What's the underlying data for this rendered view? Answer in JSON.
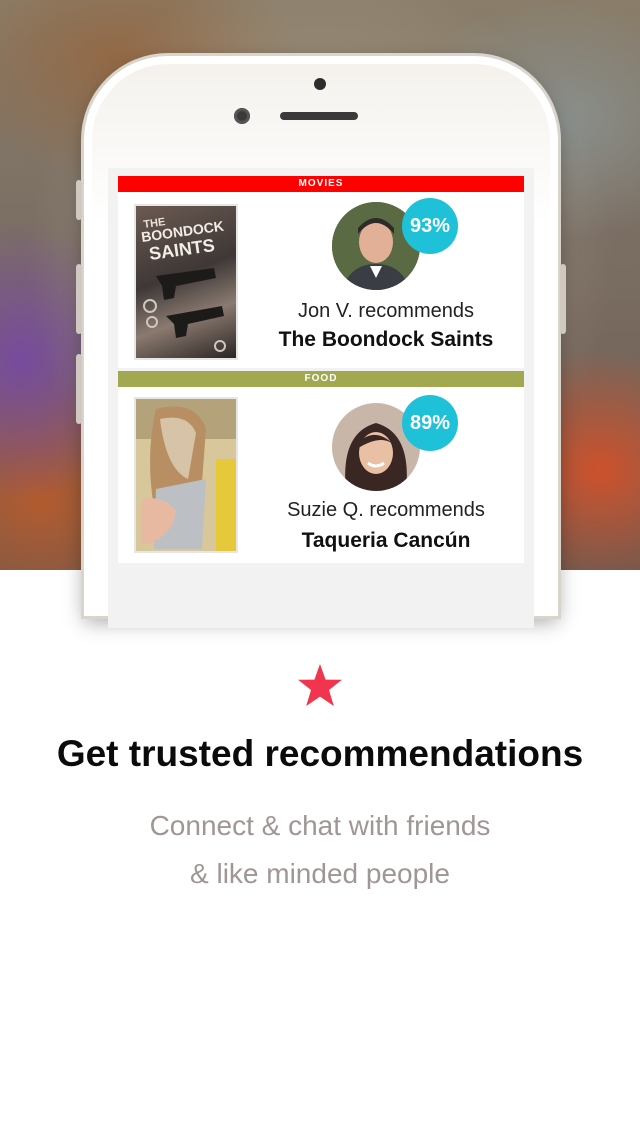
{
  "colors": {
    "movies_bar": "#ff0000",
    "food_bar": "#a2a850",
    "match_badge": "#1ec1d8",
    "star": "#f2354f",
    "subtitle_text": "#a09694"
  },
  "cards": [
    {
      "category": "MOVIES",
      "recommender_line": "Jon V. recommends",
      "title": "The Boondock Saints",
      "match": "93%",
      "poster_text": "THE BOONDOCK SAINTS"
    },
    {
      "category": "FOOD",
      "recommender_line": "Suzie Q. recommends",
      "title": "Taqueria Cancún",
      "match": "89%"
    }
  ],
  "onboarding": {
    "icon": "star-icon",
    "headline": "Get trusted recommendations",
    "subtitle_line1": "Connect & chat with friends",
    "subtitle_line2": "& like minded people"
  }
}
